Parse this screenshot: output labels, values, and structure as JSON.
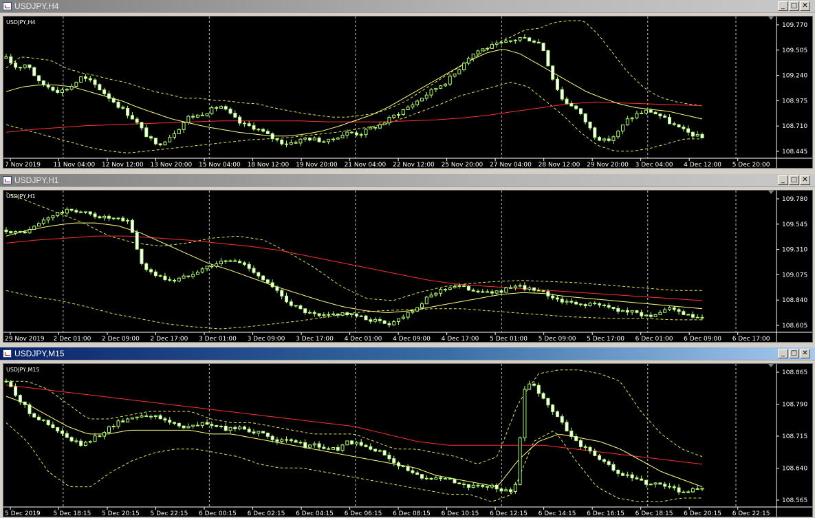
{
  "colors": {
    "background": "#000000",
    "candle_up_fill": "#000000",
    "candle_down_fill": "#ffffff",
    "candle_outline": "#b0ff70",
    "bands": "#e6e650",
    "ma_short": "#ffff80",
    "ma_long": "#ff3030",
    "grid_separator": "#c0c0c0"
  },
  "windows": [
    {
      "id": "h4",
      "title": "USDJPY,H4",
      "active": false,
      "symbol_label": "USDJPY,H4",
      "price_labels": [
        "109.770",
        "109.505",
        "109.240",
        "108.975",
        "108.710",
        "108.445"
      ],
      "time_labels": [
        "7 Nov 2019",
        "11 Nov 04:00",
        "12 Nov 12:00",
        "13 Nov 20:00",
        "15 Nov 04:00",
        "18 Nov 12:00",
        "19 Nov 20:00",
        "21 Nov 04:00",
        "22 Nov 12:00",
        "25 Nov 20:00",
        "27 Nov 04:00",
        "28 Nov 12:00",
        "29 Nov 20:00",
        "3 Dec 04:00",
        "4 Dec 12:00",
        "5 Dec 20:00"
      ],
      "chart_data": {
        "type": "candlestick",
        "timeframe": "H4",
        "ylim": [
          108.36,
          109.8
        ],
        "close_path": [
          109.4,
          109.3,
          109.35,
          109.15,
          109.1,
          109.05,
          109.1,
          109.2,
          109.15,
          109.05,
          108.95,
          108.85,
          108.75,
          108.6,
          108.48,
          108.55,
          108.65,
          108.78,
          108.8,
          108.85,
          108.9,
          108.8,
          108.7,
          108.68,
          108.62,
          108.55,
          108.5,
          108.52,
          108.56,
          108.54,
          108.52,
          108.58,
          108.62,
          108.6,
          108.66,
          108.7,
          108.78,
          108.85,
          108.92,
          109.0,
          109.08,
          109.15,
          109.25,
          109.4,
          109.48,
          109.52,
          109.55,
          109.58,
          109.62,
          109.6,
          109.55,
          109.2,
          108.95,
          108.9,
          108.75,
          108.58,
          108.52,
          108.6,
          108.75,
          108.82,
          108.85,
          108.8,
          108.72,
          108.65,
          108.6,
          108.56
        ],
        "bands_upper_path": [
          109.3,
          109.42,
          109.4,
          109.38,
          109.3,
          109.25,
          109.22,
          109.18,
          109.15,
          109.1,
          109.05,
          109.02,
          108.98,
          108.98,
          108.96,
          108.95,
          108.93,
          108.92,
          108.88,
          108.85,
          108.82,
          108.8,
          108.78,
          108.78,
          108.8,
          108.82,
          108.88,
          108.95,
          109.05,
          109.15,
          109.25,
          109.35,
          109.45,
          109.55,
          109.62,
          109.7,
          109.72,
          109.78,
          109.8,
          109.8,
          109.65,
          109.45,
          109.25,
          109.1,
          109.0,
          108.95,
          108.92,
          108.9
        ],
        "bands_lower_path": [
          108.7,
          108.65,
          108.6,
          108.55,
          108.5,
          108.45,
          108.42,
          108.4,
          108.42,
          108.44,
          108.46,
          108.48,
          108.5,
          108.52,
          108.54,
          108.55,
          108.56,
          108.58,
          108.6,
          108.62,
          108.65,
          108.68,
          108.72,
          108.78,
          108.85,
          108.92,
          109.0,
          109.05,
          109.1,
          109.15,
          109.1,
          108.95,
          108.8,
          108.62,
          108.48,
          108.42,
          108.42,
          108.45,
          108.5,
          108.55,
          108.55
        ],
        "ma_short_path": [
          109.05,
          109.1,
          109.12,
          109.12,
          109.1,
          109.05,
          109.0,
          108.95,
          108.88,
          108.82,
          108.76,
          108.72,
          108.68,
          108.65,
          108.62,
          108.6,
          108.58,
          108.58,
          108.6,
          108.63,
          108.68,
          108.74,
          108.8,
          108.88,
          108.98,
          109.08,
          109.18,
          109.28,
          109.38,
          109.46,
          109.5,
          109.45,
          109.35,
          109.25,
          109.15,
          109.05,
          108.98,
          108.92,
          108.88,
          108.86,
          108.84,
          108.8,
          108.76
        ],
        "ma_long_path": [
          108.62,
          108.65,
          108.67,
          108.69,
          108.7,
          108.71,
          108.72,
          108.73,
          108.74,
          108.74,
          108.74,
          108.74,
          108.73,
          108.73,
          108.73,
          108.74,
          108.75,
          108.77,
          108.8,
          108.84,
          108.88,
          108.92,
          108.94,
          108.93,
          108.92,
          108.91,
          108.9
        ]
      }
    },
    {
      "id": "h1",
      "title": "USDJPY,H1",
      "active": false,
      "symbol_label": "USDJPY,H1",
      "price_labels": [
        "109.780",
        "109.545",
        "109.310",
        "109.075",
        "108.840",
        "108.605"
      ],
      "time_labels": [
        "29 Nov 2019",
        "2 Dec 01:00",
        "2 Dec 09:00",
        "2 Dec 17:00",
        "3 Dec 01:00",
        "3 Dec 09:00",
        "3 Dec 17:00",
        "4 Dec 01:00",
        "4 Dec 09:00",
        "4 Dec 17:00",
        "5 Dec 01:00",
        "5 Dec 09:00",
        "5 Dec 17:00",
        "6 Dec 01:00",
        "6 Dec 09:00",
        "6 Dec 17:00"
      ],
      "chart_data": {
        "type": "candlestick",
        "timeframe": "H1",
        "ylim": [
          108.48,
          109.83
        ],
        "close_path": [
          109.48,
          109.45,
          109.47,
          109.55,
          109.62,
          109.66,
          109.68,
          109.65,
          109.62,
          109.6,
          109.58,
          109.56,
          109.15,
          109.05,
          109.0,
          108.98,
          109.02,
          109.08,
          109.12,
          109.16,
          109.18,
          109.15,
          109.08,
          108.98,
          108.88,
          108.78,
          108.7,
          108.65,
          108.62,
          108.64,
          108.66,
          108.63,
          108.6,
          108.58,
          108.55,
          108.6,
          108.68,
          108.75,
          108.85,
          108.9,
          108.93,
          108.9,
          108.88,
          108.85,
          108.88,
          108.9,
          108.92,
          108.88,
          108.85,
          108.8,
          108.76,
          108.74,
          108.75,
          108.73,
          108.7,
          108.68,
          108.66,
          108.64,
          108.62,
          108.72,
          108.65,
          108.62,
          108.6
        ],
        "bands_upper_path": [
          109.85,
          109.75,
          109.65,
          109.55,
          109.42,
          109.35,
          109.32,
          109.35,
          109.4,
          109.42,
          109.38,
          109.25,
          109.1,
          108.92,
          108.8,
          108.78,
          108.86,
          108.92,
          108.95,
          108.97,
          108.98,
          108.97,
          108.96,
          108.94,
          108.92,
          108.9,
          108.88,
          108.88
        ],
        "bands_lower_path": [
          108.88,
          108.82,
          108.78,
          108.72,
          108.65,
          108.6,
          108.55,
          108.52,
          108.5,
          108.52,
          108.55,
          108.58,
          108.62,
          108.66,
          108.68,
          108.69,
          108.7,
          108.7,
          108.68,
          108.66,
          108.64,
          108.62,
          108.61,
          108.6,
          108.6,
          108.59,
          108.59
        ],
        "ma_short_path": [
          109.42,
          109.48,
          109.52,
          109.55,
          109.55,
          109.52,
          109.45,
          109.35,
          109.25,
          109.15,
          109.08,
          109.0,
          108.92,
          108.85,
          108.78,
          108.72,
          108.68,
          108.66,
          108.68,
          108.72,
          108.76,
          108.8,
          108.84,
          108.86,
          108.85,
          108.82,
          108.8,
          108.78,
          108.76,
          108.74,
          108.72,
          108.7
        ],
        "ma_long_path": [
          109.35,
          109.38,
          109.4,
          109.42,
          109.42,
          109.4,
          109.38,
          109.35,
          109.32,
          109.28,
          109.22,
          109.16,
          109.1,
          109.04,
          108.98,
          108.94,
          108.92,
          108.9,
          108.88,
          108.86,
          108.84,
          108.82,
          108.8,
          108.78
        ]
      }
    },
    {
      "id": "m15",
      "title": "USDJPY,M15",
      "active": true,
      "symbol_label": "USDJPY,M15",
      "price_labels": [
        "108.865",
        "108.790",
        "108.715",
        "108.640",
        "108.565"
      ],
      "time_labels": [
        "5 Dec 2019",
        "5 Dec 18:15",
        "5 Dec 20:15",
        "5 Dec 22:15",
        "6 Dec 00:15",
        "6 Dec 02:15",
        "6 Dec 04:15",
        "6 Dec 06:15",
        "6 Dec 08:15",
        "6 Dec 10:15",
        "6 Dec 12:15",
        "6 Dec 14:15",
        "6 Dec 16:15",
        "6 Dec 18:15",
        "6 Dec 20:15",
        "6 Dec 22:15"
      ],
      "chart_data": {
        "type": "candlestick",
        "timeframe": "M15",
        "ylim": [
          108.53,
          108.895
        ],
        "close_path": [
          108.86,
          108.82,
          108.78,
          108.76,
          108.74,
          108.72,
          108.7,
          108.69,
          108.71,
          108.73,
          108.75,
          108.76,
          108.77,
          108.77,
          108.76,
          108.75,
          108.74,
          108.74,
          108.75,
          108.74,
          108.73,
          108.74,
          108.73,
          108.72,
          108.71,
          108.7,
          108.7,
          108.69,
          108.69,
          108.68,
          108.68,
          108.7,
          108.69,
          108.68,
          108.67,
          108.65,
          108.63,
          108.61,
          108.6,
          108.61,
          108.6,
          108.59,
          108.58,
          108.58,
          108.58,
          108.57,
          108.56,
          108.86,
          108.84,
          108.8,
          108.76,
          108.72,
          108.69,
          108.67,
          108.65,
          108.62,
          108.61,
          108.6,
          108.59,
          108.59,
          108.58,
          108.57,
          108.57,
          108.58
        ],
        "bands_upper_path": [
          108.86,
          108.86,
          108.84,
          108.8,
          108.76,
          108.76,
          108.77,
          108.78,
          108.78,
          108.78,
          108.76,
          108.75,
          108.75,
          108.74,
          108.73,
          108.72,
          108.72,
          108.72,
          108.7,
          108.68,
          108.68,
          108.67,
          108.66,
          108.64,
          108.66,
          108.8,
          108.88,
          108.89,
          108.89,
          108.88,
          108.86,
          108.78,
          108.72,
          108.68,
          108.66
        ],
        "bands_lower_path": [
          108.75,
          108.7,
          108.62,
          108.58,
          108.58,
          108.62,
          108.65,
          108.67,
          108.68,
          108.68,
          108.67,
          108.66,
          108.64,
          108.63,
          108.63,
          108.62,
          108.61,
          108.6,
          108.59,
          108.58,
          108.57,
          108.56,
          108.56,
          108.54,
          108.56,
          108.7,
          108.73,
          108.65,
          108.58,
          108.55,
          108.54,
          108.54,
          108.55,
          108.55
        ],
        "ma_short_path": [
          108.82,
          108.8,
          108.77,
          108.74,
          108.72,
          108.72,
          108.73,
          108.73,
          108.73,
          108.73,
          108.72,
          108.72,
          108.71,
          108.7,
          108.69,
          108.68,
          108.67,
          108.66,
          108.65,
          108.64,
          108.63,
          108.61,
          108.6,
          108.59,
          108.58,
          108.65,
          108.7,
          108.72,
          108.71,
          108.7,
          108.68,
          108.65,
          108.62,
          108.6,
          108.58
        ],
        "ma_long_path": [
          108.85,
          108.84,
          108.83,
          108.82,
          108.81,
          108.8,
          108.79,
          108.78,
          108.77,
          108.76,
          108.75,
          108.74,
          108.72,
          108.7,
          108.69,
          108.69,
          108.69,
          108.69,
          108.68,
          108.67,
          108.66,
          108.65,
          108.64
        ]
      }
    }
  ]
}
